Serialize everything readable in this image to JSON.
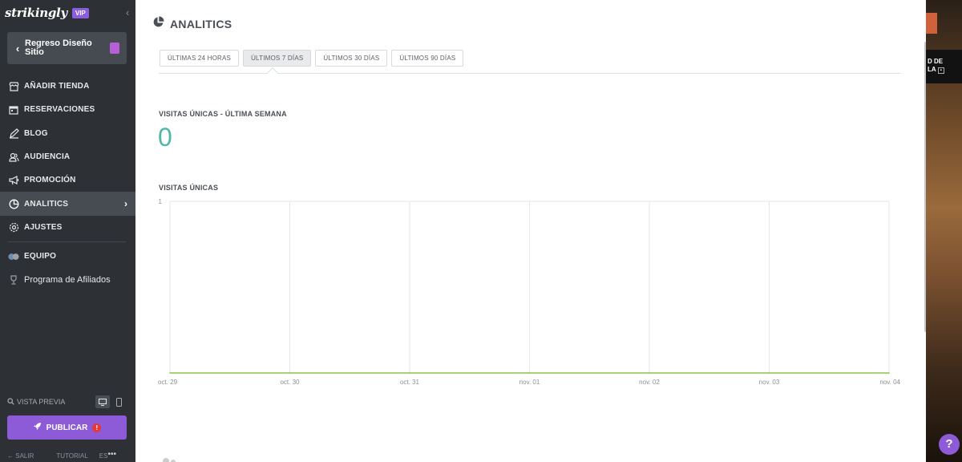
{
  "sidebar": {
    "logo": "strikingly",
    "vip": "VIP",
    "back_label": "Regreso Diseño Sitio",
    "items": [
      {
        "label": "AÑADIR TIENDA",
        "icon": "store-icon"
      },
      {
        "label": "RESERVACIONES",
        "icon": "calendar-icon"
      },
      {
        "label": "BLOG",
        "icon": "pen-icon"
      },
      {
        "label": "AUDIENCIA",
        "icon": "audience-icon"
      },
      {
        "label": "PROMOCIÓN",
        "icon": "megaphone-icon"
      },
      {
        "label": "ANALITICS",
        "icon": "pie-chart-icon",
        "active": true
      },
      {
        "label": "AJUSTES",
        "icon": "gear-icon"
      },
      {
        "label": "EQUIPO",
        "icon": "team-icon"
      },
      {
        "label": "Programa de Afiliados",
        "icon": "trophy-icon"
      }
    ],
    "preview_label": "VISTA PREVIA",
    "publish_label": "PUBLICAR",
    "publish_alert": "!",
    "footer": {
      "exit": "SALIR",
      "tutorial": "TUTORIAL",
      "lang": "ES",
      "more": "•••"
    }
  },
  "main": {
    "title": "ANALITICS",
    "tabs": [
      {
        "label": "ÚLTIMAS 24 HORAS",
        "active": false
      },
      {
        "label": "ÚLTIMOS 7 DÍAS",
        "active": true
      },
      {
        "label": "ÚLTIMOS 30 DÍAS",
        "active": false
      },
      {
        "label": "ÚLTIMOS 90 DÍAS",
        "active": false
      }
    ],
    "stat_title": "VISITAS ÚNICAS - ÚLTIMA SEMANA",
    "stat_value": "0",
    "chart_title": "VISITAS ÚNICAS"
  },
  "chart_data": {
    "type": "line",
    "title": "VISITAS ÚNICAS",
    "categories": [
      "oct. 29",
      "oct. 30",
      "oct. 31",
      "nov. 01",
      "nov. 02",
      "nov. 03",
      "nov. 04"
    ],
    "series": [
      {
        "values": [
          0,
          0,
          0,
          0,
          0,
          0,
          0
        ]
      }
    ],
    "ylim": [
      0,
      1
    ],
    "yticks": [
      "1"
    ],
    "grid": true,
    "line_color": "#8bc34a"
  },
  "overlay": {
    "side_text_1": "D DE",
    "side_text_2": "LA",
    "help": "?"
  },
  "colors": {
    "sidebar_bg": "#2d3035",
    "accent_purple": "#8e5bd8",
    "stat_teal": "#4fb7a7"
  }
}
